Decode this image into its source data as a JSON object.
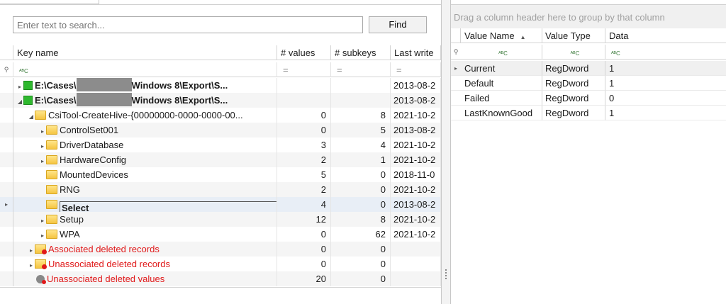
{
  "search": {
    "placeholder": "Enter text to search...",
    "find_label": "Find"
  },
  "tree_grid": {
    "columns": [
      "Key name",
      "# values",
      "# subkeys",
      "Last write"
    ],
    "rows": [
      {
        "name_prefix": "E:\\Cases\\",
        "name_suffix": "Windows 8\\Export\\S...",
        "values": "",
        "subkeys": "",
        "last_write": "2013-08-2"
      },
      {
        "name_prefix": "E:\\Cases\\",
        "name_suffix": "Windows 8\\Export\\S...",
        "values": "",
        "subkeys": "",
        "last_write": "2013-08-2"
      },
      {
        "name": "CsiTool-CreateHive-{00000000-0000-0000-00...",
        "values": "0",
        "subkeys": "8",
        "last_write": "2021-10-2"
      },
      {
        "name": "ControlSet001",
        "values": "0",
        "subkeys": "5",
        "last_write": "2013-08-2"
      },
      {
        "name": "DriverDatabase",
        "values": "3",
        "subkeys": "4",
        "last_write": "2021-10-2"
      },
      {
        "name": "HardwareConfig",
        "values": "2",
        "subkeys": "1",
        "last_write": "2021-10-2"
      },
      {
        "name": "MountedDevices",
        "values": "5",
        "subkeys": "0",
        "last_write": "2018-11-0"
      },
      {
        "name": "RNG",
        "values": "2",
        "subkeys": "0",
        "last_write": "2021-10-2"
      },
      {
        "name": "Select",
        "values": "4",
        "subkeys": "0",
        "last_write": "2013-08-2"
      },
      {
        "name": "Setup",
        "values": "12",
        "subkeys": "8",
        "last_write": "2021-10-2"
      },
      {
        "name": "WPA",
        "values": "0",
        "subkeys": "62",
        "last_write": "2021-10-2"
      },
      {
        "name": "Associated deleted records",
        "values": "0",
        "subkeys": "0",
        "last_write": ""
      },
      {
        "name": "Unassociated deleted records",
        "values": "0",
        "subkeys": "0",
        "last_write": ""
      },
      {
        "name": "Unassociated deleted values",
        "values": "20",
        "subkeys": "0",
        "last_write": ""
      }
    ]
  },
  "values_grid": {
    "group_hint": "Drag a column header here to group by that column",
    "columns": [
      "Value Name",
      "Value Type",
      "Data"
    ],
    "rows": [
      {
        "name": "Current",
        "type": "RegDword",
        "data": "1"
      },
      {
        "name": "Default",
        "type": "RegDword",
        "data": "1"
      },
      {
        "name": "Failed",
        "type": "RegDword",
        "data": "0"
      },
      {
        "name": "LastKnownGood",
        "type": "RegDword",
        "data": "1"
      }
    ]
  }
}
